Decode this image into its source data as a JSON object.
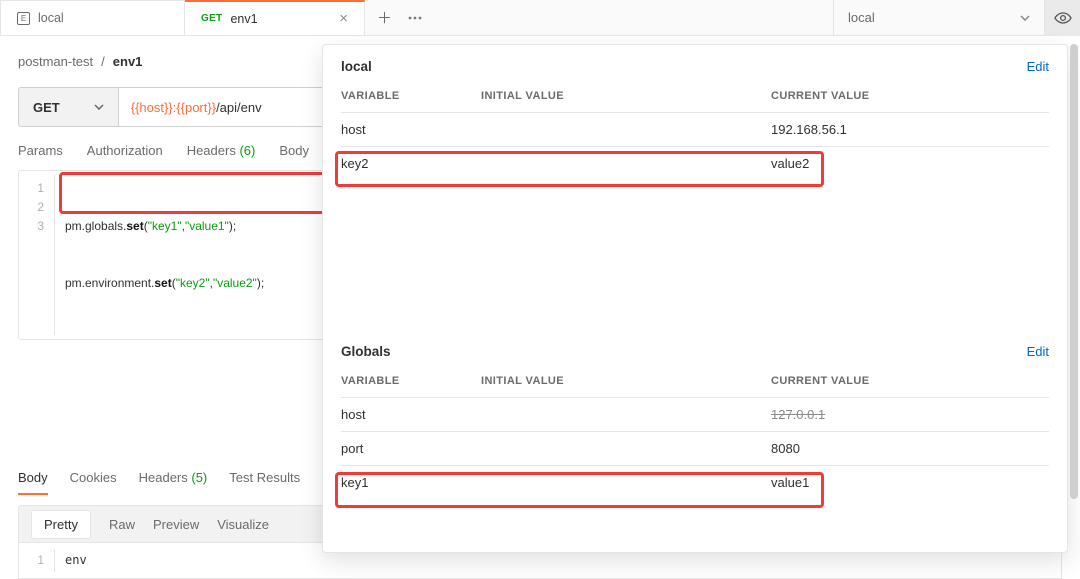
{
  "tabs": {
    "env_tab": {
      "label": "local"
    },
    "req_tab": {
      "method": "GET",
      "label": "env1"
    }
  },
  "env_dropdown": {
    "selected": "local"
  },
  "breadcrumb": {
    "collection": "postman-test",
    "request": "env1"
  },
  "request": {
    "method": "GET",
    "url_vars": "{{host}}:{{port}}",
    "url_path": "/api/env"
  },
  "subtabs": {
    "params": "Params",
    "auth": "Authorization",
    "headers": "Headers",
    "headers_count": "(6)",
    "body": "Body"
  },
  "script": {
    "lines": [
      "1",
      "2",
      "3"
    ],
    "code": [
      {
        "pre": "pm.globals.",
        "kw": "set",
        "post": "(",
        "s1": "\"key1\"",
        "c1": ",",
        "s2": "\"value1\"",
        "end": ");"
      },
      {
        "pre": "pm.environment.",
        "kw": "set",
        "post": "(",
        "s1": "\"key2\"",
        "c1": ",",
        "s2": "\"value2\"",
        "end": ");"
      }
    ]
  },
  "resp_tabs": {
    "body": "Body",
    "cookies": "Cookies",
    "headers": "Headers",
    "headers_count": "(5)",
    "tests": "Test Results"
  },
  "resp_view": {
    "pretty": "Pretty",
    "raw": "Raw",
    "preview": "Preview",
    "visualize": "Visualize"
  },
  "resp_body": {
    "ln": "1",
    "text": "env"
  },
  "popup": {
    "section_local": {
      "title": "local",
      "edit": "Edit",
      "hdr": {
        "var": "VARIABLE",
        "init": "INITIAL VALUE",
        "cur": "CURRENT VALUE"
      },
      "rows": [
        {
          "var": "host",
          "init": "",
          "cur": "192.168.56.1"
        },
        {
          "var": "key2",
          "init": "",
          "cur": "value2"
        }
      ]
    },
    "section_globals": {
      "title": "Globals",
      "edit": "Edit",
      "hdr": {
        "var": "VARIABLE",
        "init": "INITIAL VALUE",
        "cur": "CURRENT VALUE"
      },
      "rows": [
        {
          "var": "host",
          "init": "",
          "cur": "127.0.0.1",
          "strike": true
        },
        {
          "var": "port",
          "init": "",
          "cur": "8080"
        },
        {
          "var": "key1",
          "init": "",
          "cur": "value1"
        }
      ]
    }
  }
}
